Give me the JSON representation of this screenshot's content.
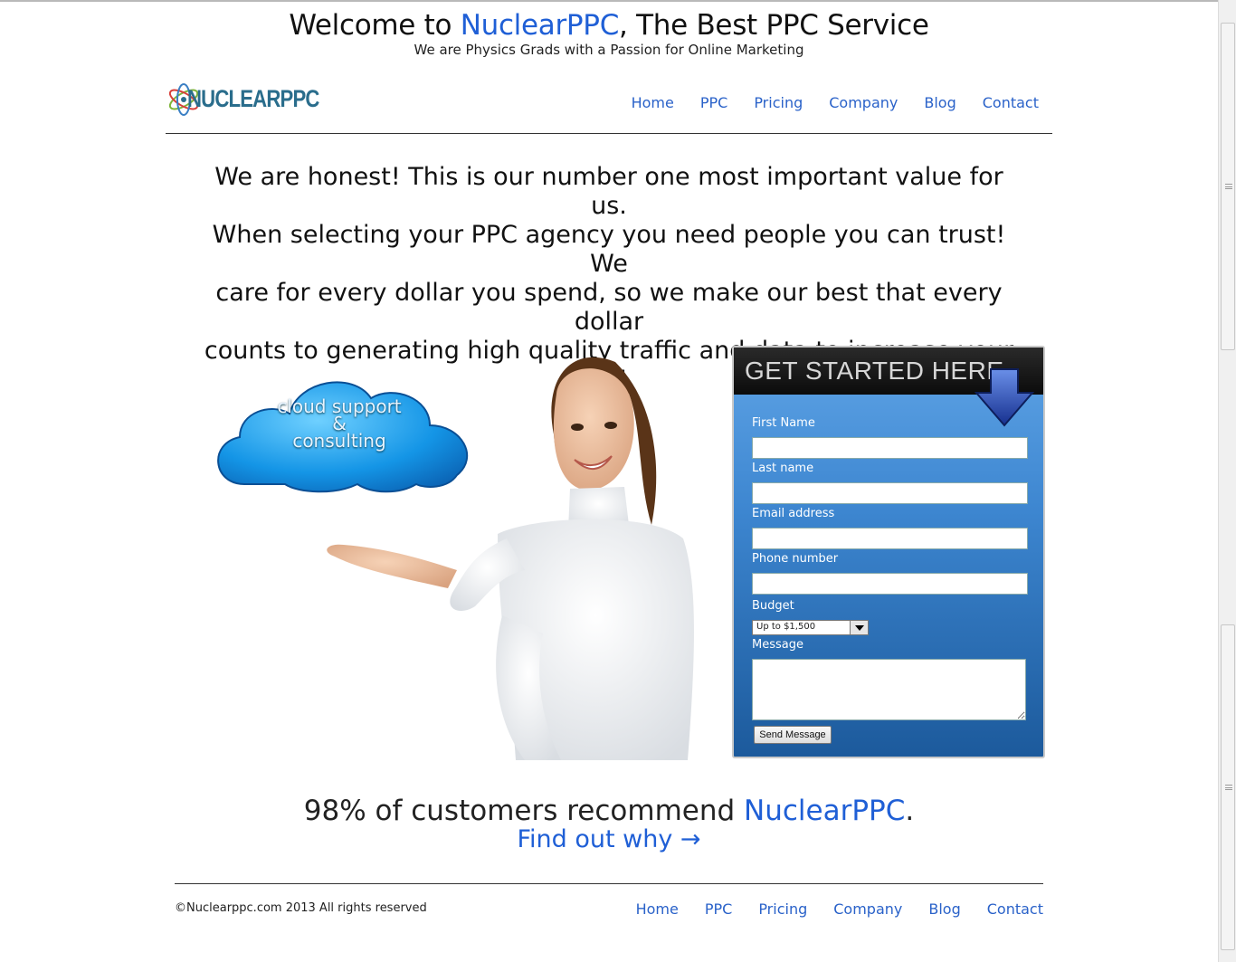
{
  "header": {
    "title_prefix": "Welcome to ",
    "title_brand": "NuclearPPC",
    "title_suffix": ", The Best PPC Service",
    "tagline": "We are Physics Grads with a Passion for Online Marketing"
  },
  "logo": {
    "text": "NUCLEARPPC"
  },
  "nav": [
    "Home",
    "PPC",
    "Pricing",
    "Company",
    "Blog",
    "Contact"
  ],
  "intro": {
    "lines": [
      "We are honest! This is our number one most important value for us.",
      "When selecting your PPC agency you need people you can trust! We",
      "care for every dollar you spend, so we make our best that every dollar",
      "counts to generating high quality traffic and data to increase your ROI."
    ]
  },
  "hero": {
    "cloud_line1": "cloud support",
    "cloud_line2": "&",
    "cloud_line3": "consulting"
  },
  "form": {
    "title": "GET STARTED HERE",
    "first_name_label": "First Name",
    "last_name_label": "Last name",
    "email_label": "Email address",
    "phone_label": "Phone number",
    "budget_label": "Budget",
    "budget_selected": "Up to $1,500",
    "message_label": "Message",
    "send_label": "Send Message"
  },
  "promo": {
    "recommend_prefix": "98% of customers recommend ",
    "recommend_brand": "NuclearPPC",
    "recommend_suffix": ".",
    "find_out": "Find out why →"
  },
  "footer": {
    "copyright": "©Nuclearppc.com 2013 All rights reserved",
    "nav": [
      "Home",
      "PPC",
      "Pricing",
      "Company",
      "Blog",
      "Contact"
    ]
  },
  "colors": {
    "link": "#2a62c9",
    "brand": "#1f5fd6",
    "panel_top": "#5fa4e6",
    "panel_bottom": "#1c5a9c"
  }
}
